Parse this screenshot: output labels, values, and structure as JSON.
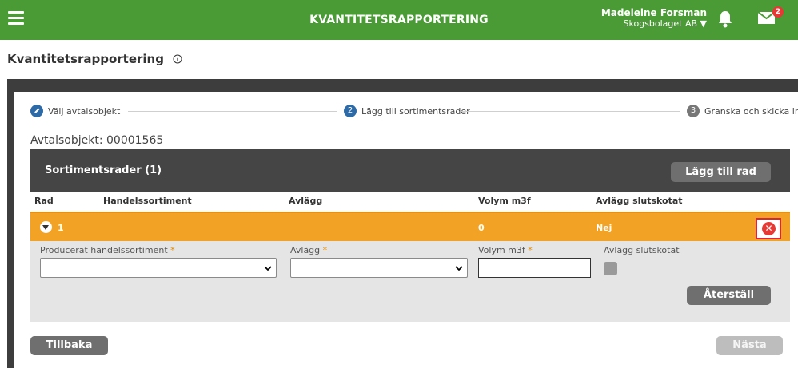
{
  "header": {
    "title": "KVANTITETSRAPPORTERING",
    "user_name": "Madeleine Forsman",
    "organization": "Skogsbolaget AB ▼",
    "mail_badge_count": "2",
    "brand_color": "#4a9a35",
    "icons": [
      "menu-icon",
      "bell-icon",
      "mail-icon"
    ]
  },
  "page": {
    "title": "Kvantitetsrapportering"
  },
  "stepper": {
    "steps": [
      {
        "label": "Välj avtalsobjekt",
        "number": "",
        "state": "done"
      },
      {
        "label": "Lägg till sortimentsrader",
        "number": "2",
        "state": "active"
      },
      {
        "label": "Granska och skicka in",
        "number": "3",
        "state": "todo"
      }
    ]
  },
  "agreement": {
    "label": "Avtalsobjekt: 00001565"
  },
  "sortiment": {
    "title": "Sortimentsrader (1)",
    "add_button": "Lägg till rad",
    "columns": [
      "Rad",
      "Handelssortiment",
      "Avlägg",
      "Volym m3f",
      "Avlägg slutskotat"
    ],
    "rows": [
      {
        "rad": "1",
        "handelssortiment": "",
        "avlagg": "",
        "volym": "0",
        "slutskotat": "Nej"
      }
    ],
    "row_color": "#f2a225"
  },
  "edit_form": {
    "product_label": "Producerat handelssortiment",
    "product_value": "",
    "avlagg_label": "Avlägg",
    "avlagg_value": "",
    "volume_label": "Volym m3f",
    "volume_value": "",
    "slutskotat_label": "Avlägg slutskotat",
    "slutskotat_checked": false,
    "required_mark": "*",
    "reset_button": "Återställ"
  },
  "footer": {
    "back_button": "Tillbaka",
    "next_button": "Nästa"
  }
}
